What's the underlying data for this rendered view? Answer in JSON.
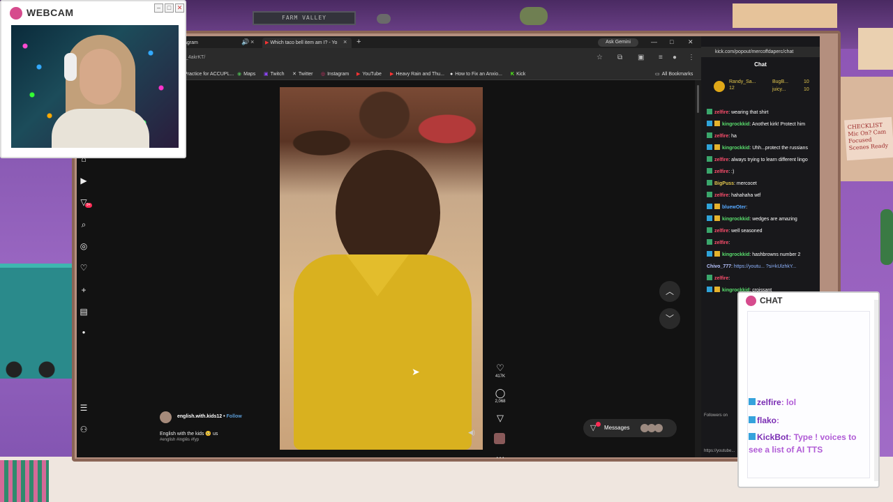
{
  "webcam": {
    "title": "WEBCAM",
    "buttons": [
      "–",
      "□",
      "✕"
    ]
  },
  "banner": {
    "text": "FARM VALLEY"
  },
  "note": {
    "text": "CHECKLIST Mic On? Cam Focused Scenes Ready"
  },
  "browser": {
    "tabs": [
      {
        "label": "agram"
      },
      {
        "label": "Which taco bell item am I? - Yo"
      }
    ],
    "gemini": "Ask Gemini",
    "url": "Tj_4akrKT/",
    "bookmarks": [
      {
        "label": "Practice for ACCUPL...",
        "icon": ""
      },
      {
        "label": "Maps",
        "icon": "◉"
      },
      {
        "label": "Twitch",
        "icon": "▣"
      },
      {
        "label": "Twitter",
        "icon": "✕"
      },
      {
        "label": "Instagram",
        "icon": "◎"
      },
      {
        "label": "YouTube",
        "icon": "▶"
      },
      {
        "label": "Heavy Rain and Thu...",
        "icon": "▶"
      },
      {
        "label": "How to Fix an Anxio...",
        "icon": "●"
      },
      {
        "label": "Kick",
        "icon": "K"
      }
    ],
    "all_bookmarks": "All Bookmarks"
  },
  "tiktok": {
    "notification_badge": "9+",
    "nav": [
      "home-icon",
      "video-icon",
      "inbox-icon",
      "search-icon",
      "explore-icon",
      "favorites-icon",
      "upload-icon",
      "analytics-icon",
      "profile-icon"
    ],
    "likes": "417K",
    "comments": "2,068",
    "author": "english.with.kids12",
    "follow": "Follow",
    "caption": "English with the kids 🥺 us",
    "tags": "#english #inglês #fyp",
    "messages": "Messages"
  },
  "kick_chat": {
    "url": "kick.com/popout/mercoffdaperc/chat",
    "title": "Chat",
    "top_gifters": [
      {
        "name": "Randy_Sa...",
        "count": "12"
      },
      {
        "name": "BugB...",
        "count": "10"
      },
      {
        "name": "juicy...",
        "count": "10"
      }
    ],
    "messages": [
      {
        "user": "zelfire",
        "color": "#ff4f6d",
        "text": "wearing that shirt",
        "badges": [
          "green"
        ]
      },
      {
        "user": "kingrockkid",
        "color": "#5adf6e",
        "text": "Anothet kirk! Protect him",
        "badges": [
          "blue",
          "gold",
          "gold"
        ]
      },
      {
        "user": "zelfire",
        "color": "#ff4f6d",
        "text": "ha",
        "badges": [
          "green"
        ]
      },
      {
        "user": "kingrockkid",
        "color": "#5adf6e",
        "text": "Uhh...protect the russians",
        "badges": [
          "blue",
          "gold",
          "gold"
        ]
      },
      {
        "user": "zelfire",
        "color": "#ff4f6d",
        "text": "always trying to learn different lingo",
        "badges": [
          "green"
        ]
      },
      {
        "user": "zelfire",
        "color": "#ff4f6d",
        "text": ":)",
        "badges": [
          "green"
        ]
      },
      {
        "user": "BigPuss",
        "color": "#e3c74e",
        "text": "mercocet",
        "badges": [
          "green"
        ]
      },
      {
        "user": "zelfire",
        "color": "#ff4f6d",
        "text": "hahahaha wtf",
        "badges": [
          "green"
        ]
      },
      {
        "user": "bluewOter",
        "color": "#57a9ff",
        "text": "",
        "badges": [
          "blue",
          "gold",
          "gold"
        ]
      },
      {
        "user": "kingrockkid",
        "color": "#5adf6e",
        "text": "wedges are amazing",
        "badges": [
          "blue",
          "gold",
          "gold"
        ]
      },
      {
        "user": "zelfire",
        "color": "#ff4f6d",
        "text": "well seasoned",
        "badges": [
          "green"
        ]
      },
      {
        "user": "zelfire",
        "color": "#ff4f6d",
        "text": "",
        "badges": [
          "green"
        ]
      },
      {
        "user": "kingrockkid",
        "color": "#5adf6e",
        "text": "hashbrowns number 2",
        "badges": [
          "blue",
          "gold",
          "gold"
        ]
      },
      {
        "user": "Chivo_777",
        "color": "#b8c4ff",
        "text": "https://youtu... ?si=kUlzhkY...",
        "badges": []
      },
      {
        "user": "zelfire",
        "color": "#ff4f6d",
        "text": "",
        "badges": [
          "green"
        ]
      },
      {
        "user": "kingrockkid",
        "color": "#5adf6e",
        "text": "croissant",
        "badges": [
          "blue",
          "gold",
          "gold"
        ]
      }
    ],
    "footer_text": "Followers on",
    "footer_link": "https://youtube..."
  },
  "tts_widget": {
    "title": "CHAT",
    "messages": [
      {
        "user": "zelfire",
        "text": "lol"
      },
      {
        "user": "flako",
        "text": ""
      },
      {
        "user": "KickBot",
        "text": "Type ! voices to see a list of AI TTS"
      }
    ]
  }
}
